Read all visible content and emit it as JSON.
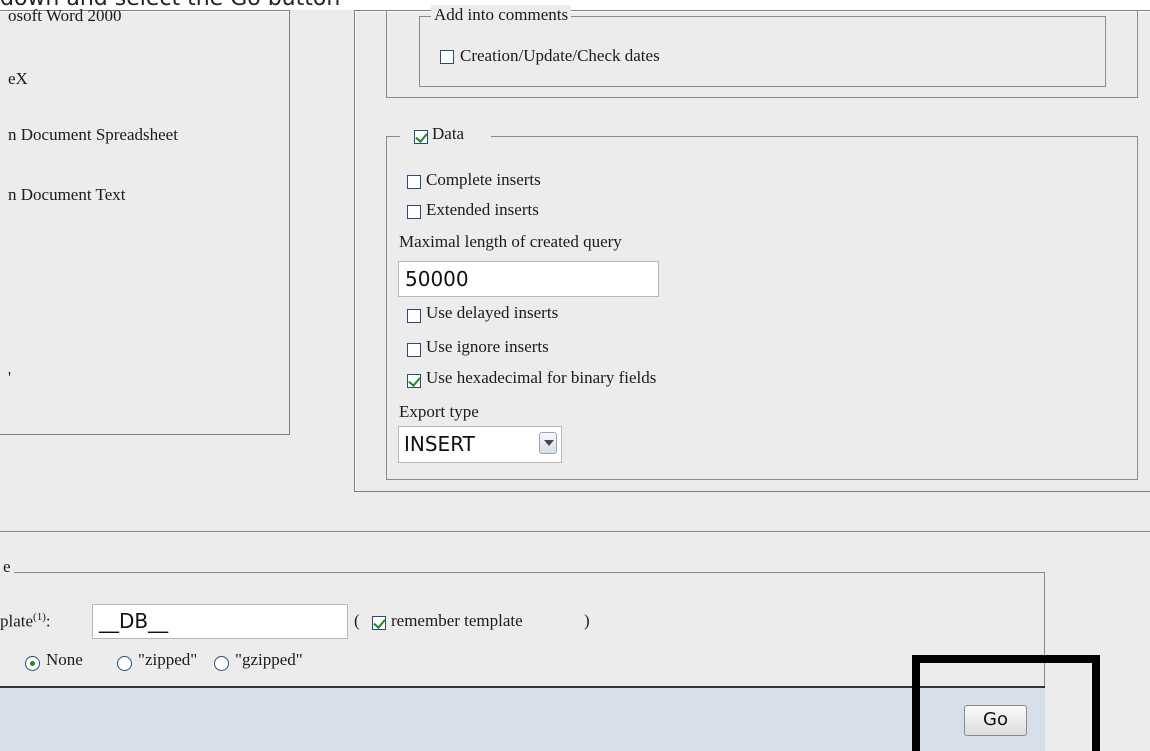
{
  "instruction_text": "down and select the Go button",
  "left_panel": {
    "formats": [
      "osoft Word 2000",
      "eX",
      "n Document Spreadsheet",
      "n Document Text",
      "'"
    ]
  },
  "comments_group": {
    "legend": "Add into comments",
    "creation_dates_label": "Creation/Update/Check dates"
  },
  "data_group": {
    "legend": "Data",
    "complete_inserts_label": "Complete inserts",
    "extended_inserts_label": "Extended inserts",
    "max_length_label": "Maximal length of created query",
    "max_length_value": "50000",
    "delayed_inserts_label": "Use delayed inserts",
    "ignore_inserts_label": "Use ignore inserts",
    "hexadecimal_label": "Use hexadecimal for binary fields",
    "export_type_label": "Export type",
    "export_type_value": "INSERT"
  },
  "save_group": {
    "legend": "e",
    "template_label_prefix": "plate",
    "template_superscript": "(1)",
    "template_label_suffix": ":",
    "template_value": "__DB__",
    "paren_open": "(",
    "remember_template_label": "remember template",
    "paren_close": ")",
    "compression_none": "None",
    "compression_zipped": "\"zipped\"",
    "compression_gzipped": "\"gzipped\""
  },
  "footer": {
    "go_label": "Go"
  },
  "colors": {
    "background": "#ececec",
    "footer": "#d5dee9",
    "highlight_box": "#000000",
    "check_green": "#1f8b1f"
  }
}
